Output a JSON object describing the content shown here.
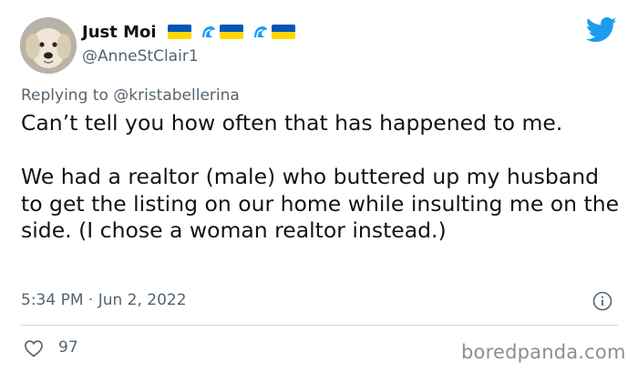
{
  "author": {
    "display_name": "Just Moi",
    "handle": "@AnneStClair1",
    "avatar_icon": "dog-avatar",
    "name_emojis": [
      "ukraine-flag",
      "wave",
      "ukraine-flag",
      "wave",
      "ukraine-flag"
    ]
  },
  "reply": {
    "prefix": "Replying to",
    "mention": "@kristabellerina"
  },
  "tweet": {
    "paragraph_1": "Can’t tell you how often that has happened to me.",
    "paragraph_2": "We had a realtor (male) who buttered up my husband to get the listing on our home while insulting me on the side. (I chose a woman realtor instead.)",
    "timestamp": "5:34 PM · Jun 2, 2022"
  },
  "engagement": {
    "likes": "97"
  },
  "colors": {
    "twitter_blue": "#1d9bf0",
    "secondary_text": "#536471",
    "flag_blue": "#0057b7",
    "flag_yellow": "#ffd700"
  },
  "watermark": "boredpanda.com"
}
